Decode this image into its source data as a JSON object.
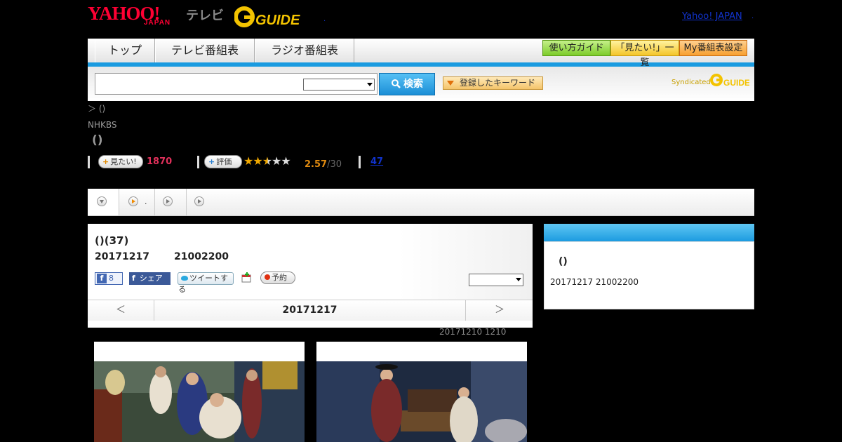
{
  "header": {
    "yahoo_logo": "YAHOO!",
    "yahoo_sub": "JAPAN",
    "tv_label": "テレビ",
    "gguide_logo": "G-GUIDE",
    "yahoo_japan_link": "Yahoo! JAPAN",
    "link_dot": "."
  },
  "nav": {
    "tabs": [
      {
        "label": "トップ"
      },
      {
        "label": "テレビ番組表"
      },
      {
        "label": "ラジオ番組表"
      }
    ],
    "right_buttons": [
      {
        "label": "使い方ガイド"
      },
      {
        "label": "「見たい!」一覧"
      },
      {
        "label": "My番組表設定"
      }
    ]
  },
  "search": {
    "input_value": "",
    "select_value": "",
    "button_label": "検索",
    "keyword_button_label": "登録したキーワード",
    "syndicated_label": "Syndicated",
    "syndicated_logo": "GUIDE"
  },
  "breadcrumb": "＞ ()",
  "program": {
    "channel": "NHKBS",
    "title": "()",
    "mitai_label": "見たい!",
    "mitai_count": "1870",
    "rating_label": "評価",
    "rating_value": "2.57",
    "rating_suffix": "/30",
    "rating_stars": 2.57,
    "review_link": "47"
  },
  "tabs_bar": {
    "items": [
      {
        "icon": "chevron-down-icon",
        "label": ""
      },
      {
        "icon": "play-icon",
        "label": "."
      },
      {
        "icon": "play-icon",
        "label": ""
      },
      {
        "icon": "play-icon",
        "label": ""
      }
    ]
  },
  "episode": {
    "title": "()(37)",
    "date": "20171217",
    "time": "21002200",
    "fb_like_count": "8",
    "fb_share_label": "シェア",
    "tweet_label": "ツイートする",
    "reserve_label": "予約",
    "select_value": ""
  },
  "date_nav": {
    "prev": "＜",
    "current": "20171217",
    "next": "＞"
  },
  "past_note": "20171210 1210",
  "right_panel": {
    "header": "",
    "title": "()",
    "date": "20171217 21002200"
  },
  "thumbnails": [
    {
      "caption": ""
    },
    {
      "caption": ""
    }
  ],
  "colors": {
    "accent_blue": "#1a9be0",
    "link": "#1133cc",
    "mitai_red": "#e0305a",
    "rating_orange": "#e08a10"
  }
}
